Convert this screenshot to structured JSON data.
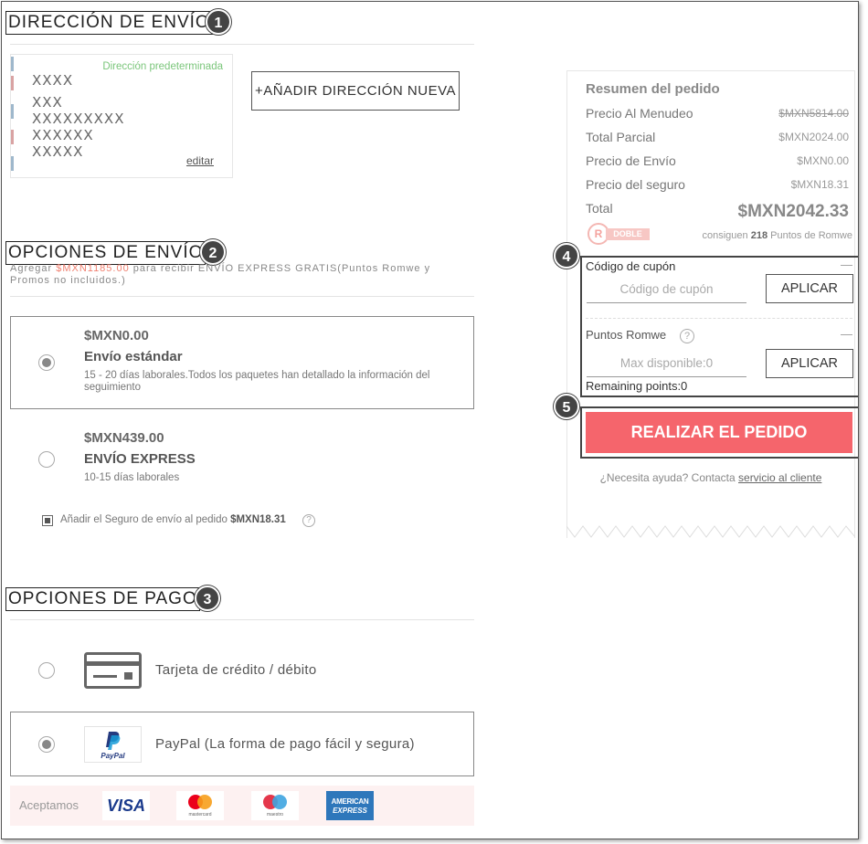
{
  "shipping_address": {
    "title": "DIRECCIÓN DE ENVÍO",
    "step": "1",
    "default_label": "Dirección predeterminada",
    "lines": [
      "XXXX",
      "XXX",
      "XXXXXXXXX",
      "XXXXXX",
      "XXXXX"
    ],
    "edit_label": "editar",
    "add_new_label": "+AÑADIR DIRECCIÓN NUEVA"
  },
  "shipping_options": {
    "title": "OPCIONES DE ENVÍO",
    "step": "2",
    "notice_prefix": "Agregar ",
    "notice_amount": "$MXN1185.00",
    "notice_suffix": " para recibir ENVÍO EXPRESS GRATIS(Puntos Romwe y Promos no incluidos.)",
    "options": [
      {
        "price": "$MXN0.00",
        "name": "Envío estándar",
        "desc": "15 - 20 días laborales.Todos los paquetes han detallado la información del seguimiento",
        "selected": true
      },
      {
        "price": "$MXN439.00",
        "name": "ENVÍO EXPRESS",
        "desc": "10-15 días laborales",
        "selected": false
      }
    ],
    "insurance_label": "Añadir el Seguro de envío al pedido ",
    "insurance_amount": "$MXN18.31",
    "help_glyph": "?"
  },
  "payment_options": {
    "title": "OPCIONES DE PAGO",
    "step": "3",
    "methods": [
      {
        "label": "Tarjeta de crédito / débito",
        "icon": "credit-card-icon",
        "selected": false
      },
      {
        "label": "PayPal (La forma de pago fácil y segura)",
        "icon": "paypal-logo",
        "logo_text": "PayPal",
        "selected": true
      }
    ],
    "accept_label": "Aceptamos",
    "cards": [
      {
        "name": "visa",
        "text": "VISA"
      },
      {
        "name": "mastercard",
        "text": "mastercard"
      },
      {
        "name": "maestro",
        "text": "maestro"
      },
      {
        "name": "american-express",
        "text_top": "AMERICAN",
        "text_bottom": "EXPRESS"
      }
    ]
  },
  "order_summary": {
    "title": "Resumen del pedido",
    "rows": [
      {
        "label": "Precio Al Menudeo",
        "value": "$MXN5814.00",
        "strike": true
      },
      {
        "label": "Total Parcial",
        "value": "$MXN2024.00",
        "strike": false
      },
      {
        "label": "Precio de Envío",
        "value": "$MXN0.00",
        "strike": false
      },
      {
        "label": "Precio del seguro",
        "value": "$MXN18.31",
        "strike": false
      }
    ],
    "total_label": "Total",
    "total_value": "$MXN2042.33",
    "badge_r": "R",
    "badge_text": "DOBLE",
    "points_prefix": "consiguen ",
    "points_value": "218",
    "points_suffix": " Puntos de Romwe",
    "coupon_step": "4",
    "coupon_title": "Código de cupón",
    "coupon_placeholder": "Código de cupón",
    "apply_label": "APLICAR",
    "points_title": "Puntos Romwe",
    "points_placeholder": "Max disponible:0",
    "collapse_glyph": "—",
    "remaining": "Remaining points:0",
    "place_step": "5",
    "place_order_label": "REALIZAR EL PEDIDO",
    "help_prefix": "¿Necesita ayuda? Contacta ",
    "help_link": "servicio al cliente"
  },
  "colors": {
    "accent": "#f5656c",
    "default_tag": "#7bc67b",
    "highlight": "#f08070"
  }
}
